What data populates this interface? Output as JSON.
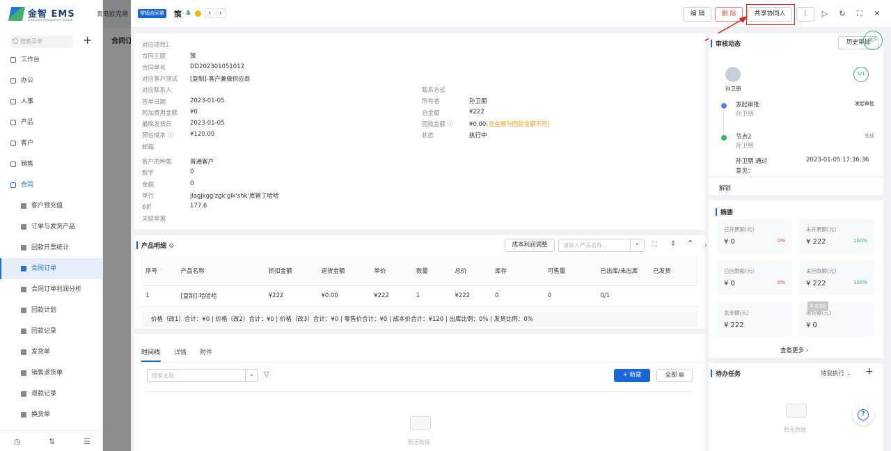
{
  "sidebar": {
    "logo_text": "金智 EMS",
    "logo_sub": "Enterprise Management System",
    "company": "青岛欧克德",
    "search_placeholder": "搜索菜单",
    "add_label": "+",
    "items": [
      {
        "label": "工作台"
      },
      {
        "label": "办公"
      },
      {
        "label": "人事"
      },
      {
        "label": "产品"
      },
      {
        "label": "客户"
      },
      {
        "label": "销售"
      },
      {
        "label": "合同"
      }
    ],
    "sub_items": [
      {
        "label": "客户预充值"
      },
      {
        "label": "订单与发货产品"
      },
      {
        "label": "回款开票统计"
      },
      {
        "label": "合同订单"
      },
      {
        "label": "合同订单利润分析"
      },
      {
        "label": "回款计划"
      },
      {
        "label": "回款记录"
      },
      {
        "label": "发货单"
      },
      {
        "label": "销售退货单"
      },
      {
        "label": "退款记录"
      },
      {
        "label": "换货单"
      }
    ]
  },
  "background_page": {
    "title": "合同订"
  },
  "header": {
    "type_tag": "常规合同单",
    "title": "策",
    "edit_label": "编 辑",
    "delete_label": "删 除",
    "share_label": "共享协同人",
    "more_label": "⋮"
  },
  "info": {
    "left": [
      {
        "k": "对应项目1",
        "v": ""
      },
      {
        "k": "合同主题",
        "v": "策"
      },
      {
        "k": "合同单号",
        "v": "DD202301051012"
      },
      {
        "k": "对应客户测试",
        "v": "[复制]-客户兼做供应商"
      },
      {
        "k": "对应联系人",
        "v": ""
      },
      {
        "k": "签单日期",
        "v": "2023-01-05"
      },
      {
        "k": "附加费用金额",
        "v": "¥0"
      },
      {
        "k": "最晚发货日",
        "v": "2023-01-05"
      },
      {
        "k": "预估成本 ⓘ",
        "v": "¥120.00"
      },
      {
        "k": "邮箱",
        "v": ""
      },
      {
        "k": "客户的种类",
        "v": "普通客户"
      },
      {
        "k": "数字",
        "v": "0"
      },
      {
        "k": "金额",
        "v": "0"
      },
      {
        "k": "单行",
        "v": "jlagjkgg'zgk'gik'shk'库管了哈哈"
      },
      {
        "k": "8折",
        "v": "177.6"
      },
      {
        "k": "关联单据",
        "v": ""
      }
    ],
    "right": [
      {
        "k": "联系方式",
        "v": ""
      },
      {
        "k": "所有者",
        "v": "孙卫朋"
      },
      {
        "k": "总金额",
        "v": "¥222"
      },
      {
        "k": "回款金额 ⓘ",
        "v": "¥0.00",
        "warn": "(总金额与回款金额不符)"
      },
      {
        "k": "状态",
        "v": "执行中"
      }
    ]
  },
  "products": {
    "title": "产品明细",
    "cost_button": "成本利润调整",
    "search_placeholder": "请输入产品名称...",
    "columns": [
      "序号",
      "产品名称",
      "折扣金额",
      "退货金额",
      "单价",
      "数量",
      "总价",
      "库存",
      "可售量",
      "已出库/未出库",
      "已发货"
    ],
    "rows": [
      [
        "1",
        "[复制]-哈哈哈",
        "¥222",
        "¥0.00",
        "¥222",
        "1",
        "¥222",
        "0",
        "0",
        "0/1",
        ""
      ]
    ],
    "summary": "价格（改1）合计：¥0 |   价格（改2）合计：¥0 |   价格（改3）合计：¥0 |   零售价合计：¥0 |   成本价合计：¥120 |   出库比例：0% |   发货比例：0%"
  },
  "timeline": {
    "tabs": [
      "时间线",
      "详情",
      "附件"
    ],
    "search_placeholder": "搜索主题",
    "new_label": "+ 新建",
    "all_label": "全部 ⊠",
    "empty": "暂无数据"
  },
  "approval": {
    "title": "审核动态",
    "history_label": "历史审批",
    "stamp": "通过",
    "user": "孙卫朋",
    "progress": "1/1",
    "step1_name": "发起审批",
    "step1_user": "孙卫朋",
    "step1_status": "发起审批",
    "step2_name": "节点2",
    "step2_user": "孙卫朋",
    "step2_status": "完成",
    "pass_text": "孙卫朋 通过",
    "pass_time": "2023-01-05 17:36:36",
    "opinion_label": "意见：",
    "unlock_label": "解锁"
  },
  "summary": {
    "title": "摘要",
    "boxes": [
      {
        "label": "已开票额(元)",
        "value": "¥ 0",
        "pct": "0%",
        "pct_color": "#e44"
      },
      {
        "label": "未开票额(元)",
        "value": "¥ 222",
        "pct": "100%",
        "pct_color": "#3bb36b"
      },
      {
        "label": "已回款额(元)",
        "value": "¥ 0",
        "pct": "0%",
        "pct_color": "#e44"
      },
      {
        "label": "未回款额(元)",
        "value": "¥ 222",
        "pct": "100%",
        "pct_color": "#3bb36b"
      },
      {
        "label": "总金额(元)",
        "value": "¥ 222",
        "pct": "",
        "pct_color": "#3bb36b"
      },
      {
        "label": "退货额(元)",
        "value": "¥ 0",
        "pct": "",
        "pct_color": "#3bb36b"
      }
    ],
    "tooltip": "¥ 0.00",
    "more_label": "查看更多 ›"
  },
  "todo": {
    "title": "待办任务",
    "filter": "待我执行 ⌄",
    "add": "+",
    "empty": "暂无数据"
  },
  "colors": {
    "accent": "#1a66d6",
    "danger": "#e44",
    "success": "#3bb36b",
    "warning": "#f0a020"
  }
}
